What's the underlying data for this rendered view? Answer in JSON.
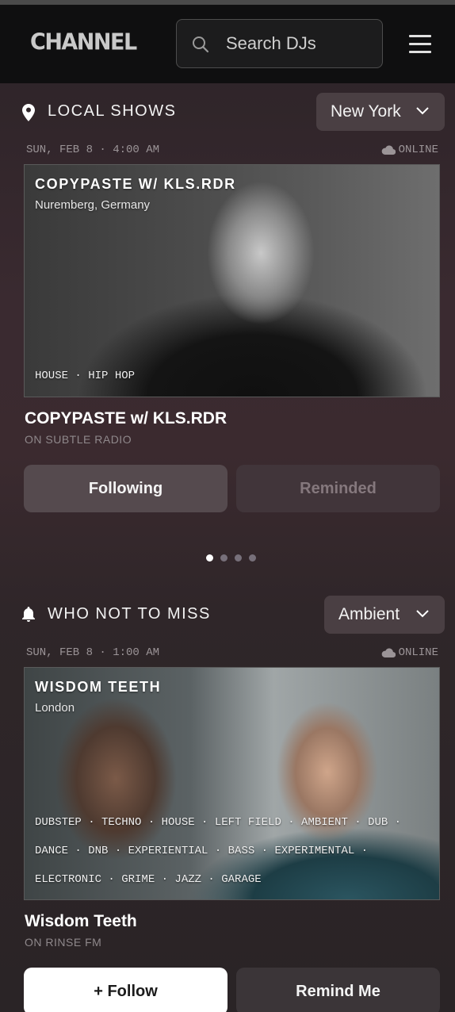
{
  "header": {
    "logo": "CHANNEL",
    "search_placeholder": "Search DJs"
  },
  "local_shows": {
    "heading": "LOCAL SHOWS",
    "city": "New York",
    "date": "SUN, FEB 8 · 4:00 AM",
    "online_label": "ONLINE",
    "card_title": "COPYPASTE W/ KLS.RDR",
    "card_location": "Nuremberg, Germany",
    "tags": "HOUSE · HIP HOP",
    "show_name": "COPYPASTE w/ KLS.RDR",
    "station": "ON SUBTLE RADIO",
    "follow_button": "Following",
    "remind_button": "Reminded",
    "carousel_count": 4,
    "carousel_active": 0
  },
  "who_not_to_miss": {
    "heading": "WHO NOT TO MISS",
    "genre": "Ambient",
    "date": "SUN, FEB 8 · 1:00 AM",
    "online_label": "ONLINE",
    "card_title": "WISDOM TEETH",
    "card_location": "London",
    "tags_line1": "DUBSTEP · TECHNO · HOUSE · LEFT FIELD · AMBIENT · DUB ·",
    "tags_line2": "DANCE · DNB · EXPERIENTIAL · BASS · EXPERIMENTAL ·",
    "tags_line3": "ELECTRONIC · GRIME · JAZZ · GARAGE",
    "show_name": "Wisdom Teeth",
    "station": "ON RINSE FM",
    "follow_button": "+ Follow",
    "remind_button": "Remind Me"
  },
  "icons": {
    "search": "search-icon",
    "menu": "hamburger-menu-icon",
    "location": "location-pin-icon",
    "bell": "bell-icon",
    "cloud": "cloud-icon",
    "chevron": "chevron-down-icon"
  }
}
